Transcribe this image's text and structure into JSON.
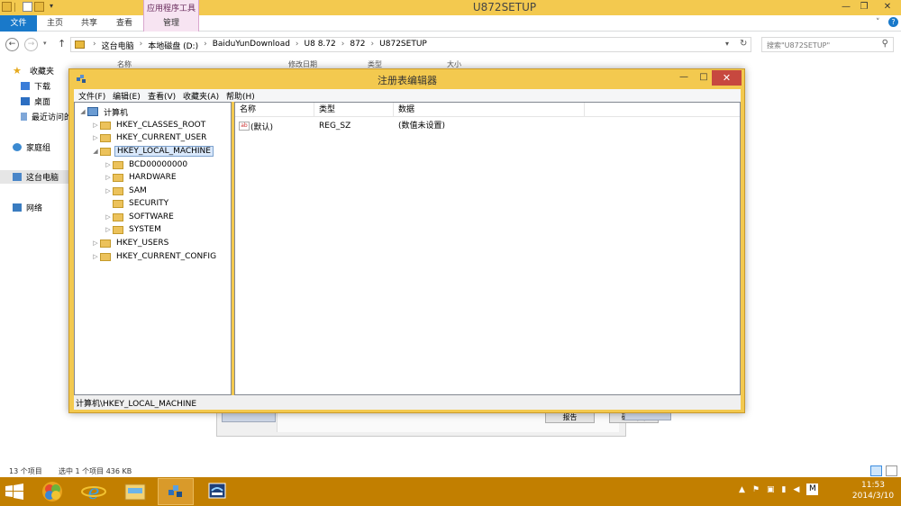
{
  "explorer": {
    "window_title": "U872SETUP",
    "ribbon": {
      "contextual_tool_label": "应用程序工具",
      "tabs": [
        "文件",
        "主页",
        "共享",
        "查看",
        "管理"
      ]
    },
    "address": {
      "crumbs": [
        "这台电脑",
        "本地磁盘 (D:)",
        "BaiduYunDownload",
        "U8 8.72",
        "872",
        "U872SETUP"
      ]
    },
    "search_placeholder": "搜索\"U872SETUP\"",
    "nav_pane": {
      "favorites": "收藏夹",
      "downloads": "下载",
      "desktop": "桌面",
      "recent": "最近访问的",
      "homegroup": "家庭组",
      "this_pc": "这台电脑",
      "network": "网络"
    },
    "columns": [
      "名称",
      "修改日期",
      "类型",
      "大小"
    ],
    "status": {
      "item_count": "13 个项目",
      "selected": "选中 1 个项目  436 KB"
    }
  },
  "background_dialog": {
    "report_label": "报告",
    "ok_label": "确定(K)"
  },
  "regedit": {
    "title": "注册表编辑器",
    "menu": [
      "文件(F)",
      "编辑(E)",
      "查看(V)",
      "收藏夹(A)",
      "帮助(H)"
    ],
    "tree": {
      "root": "计算机",
      "hives": [
        "HKEY_CLASSES_ROOT",
        "HKEY_CURRENT_USER",
        "HKEY_LOCAL_MACHINE",
        "HKEY_USERS",
        "HKEY_CURRENT_CONFIG"
      ],
      "hklm_children": [
        "BCD00000000",
        "HARDWARE",
        "SAM",
        "SECURITY",
        "SOFTWARE",
        "SYSTEM"
      ]
    },
    "list": {
      "headers": [
        "名称",
        "类型",
        "数据"
      ],
      "rows": [
        {
          "name": "(默认)",
          "type": "REG_SZ",
          "data": "(数值未设置)"
        }
      ]
    },
    "statusbar": "计算机\\HKEY_LOCAL_MACHINE"
  },
  "taskbar": {
    "ime_indicator": "M",
    "clock_time": "11:53",
    "clock_date": "2014/3/10"
  },
  "colors": {
    "window_frame": "#f3c94f",
    "taskbar": "#c27f00",
    "file_tab": "#1979ca",
    "close_button": "#c7483f",
    "selection": "#d9e8fb"
  }
}
